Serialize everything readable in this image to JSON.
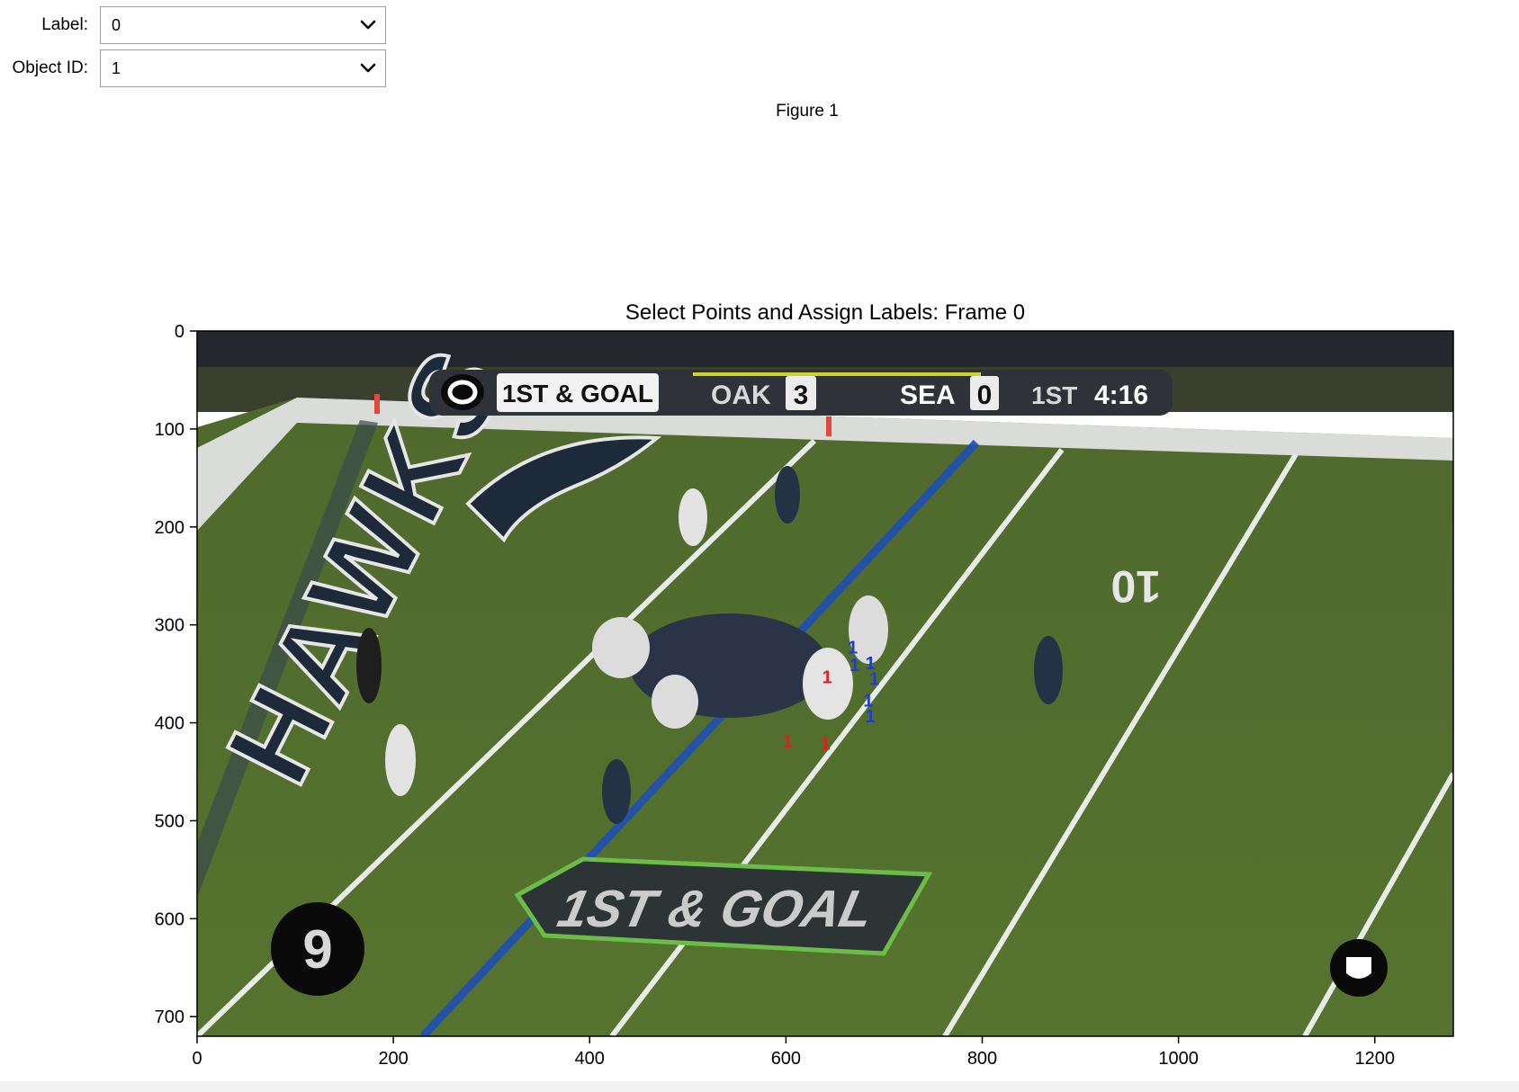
{
  "controls": {
    "label_caption": "Label:",
    "label_value": "0",
    "object_caption": "Object ID:",
    "object_value": "1"
  },
  "figure": {
    "window_title": "Figure 1",
    "plot_title": "Select Points and Assign Labels: Frame 0"
  },
  "axes": {
    "x_ticks": [
      "0",
      "200",
      "400",
      "600",
      "800",
      "1000",
      "1200"
    ],
    "y_ticks": [
      "0",
      "100",
      "200",
      "300",
      "400",
      "500",
      "600",
      "700"
    ],
    "xlim": [
      0,
      1280
    ],
    "ylim": [
      720,
      0
    ]
  },
  "broadcast": {
    "down_text": "1ST & GOAL",
    "away_team": "OAK",
    "away_score": "3",
    "home_team": "SEA",
    "home_score": "0",
    "quarter": "1ST",
    "clock": "4:16",
    "timer_badge": "9",
    "field_text": "1ST & GOAL",
    "endzone_text": "HAWKS"
  },
  "annotations": {
    "marker_label": "1",
    "colors": {
      "positive": "#1f3bd6",
      "negative": "#e02020"
    },
    "points": [
      {
        "x": 668,
        "y": 322,
        "label": 1
      },
      {
        "x": 670,
        "y": 340,
        "label": 1
      },
      {
        "x": 686,
        "y": 338,
        "label": 1
      },
      {
        "x": 690,
        "y": 354,
        "label": 1
      },
      {
        "x": 684,
        "y": 376,
        "label": 1
      },
      {
        "x": 686,
        "y": 392,
        "label": 1
      },
      {
        "x": 642,
        "y": 352,
        "label": 0
      },
      {
        "x": 602,
        "y": 418,
        "label": 0
      },
      {
        "x": 640,
        "y": 420,
        "label": 0
      }
    ]
  }
}
